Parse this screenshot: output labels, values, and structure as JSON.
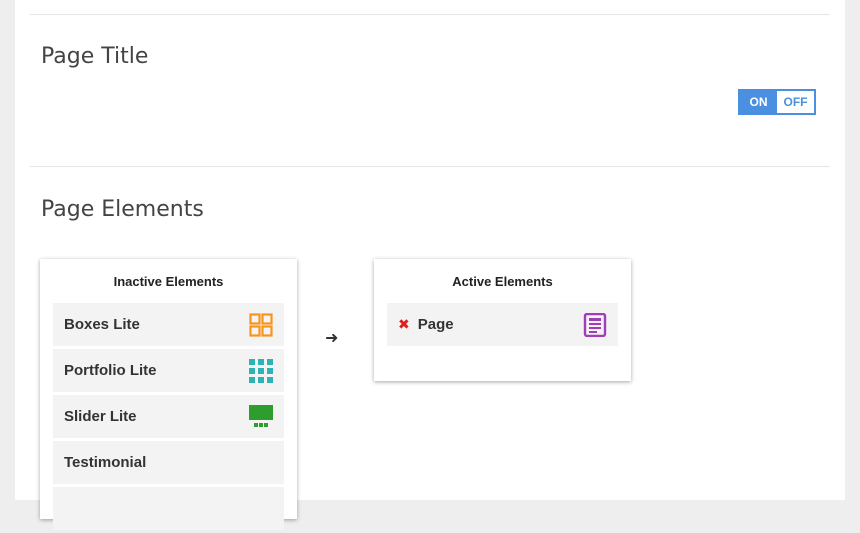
{
  "page_title_section": {
    "heading": "Page Title",
    "toggle": {
      "on_label": "ON",
      "off_label": "OFF",
      "state": "on"
    }
  },
  "page_elements_section": {
    "heading": "Page Elements",
    "inactive": {
      "title": "Inactive Elements",
      "items": [
        {
          "label": "Boxes Lite",
          "icon": "grid-boxes-icon",
          "color": "#f7941d"
        },
        {
          "label": "Portfolio Lite",
          "icon": "portfolio-grid-icon",
          "color": "#2db3b3"
        },
        {
          "label": "Slider Lite",
          "icon": "slider-icon",
          "color": "#2d9e2d"
        },
        {
          "label": "Testimonial",
          "icon": "",
          "color": ""
        },
        {
          "label": "",
          "icon": "",
          "color": ""
        }
      ]
    },
    "active": {
      "title": "Active Elements",
      "items": [
        {
          "label": "Page",
          "icon": "page-document-icon",
          "color": "#a03db8",
          "remove_icon": "close-icon"
        }
      ]
    },
    "arrow_icon": "arrow-right-icon"
  },
  "colors": {
    "accent": "#4a8fe0",
    "remove": "#e02020"
  }
}
